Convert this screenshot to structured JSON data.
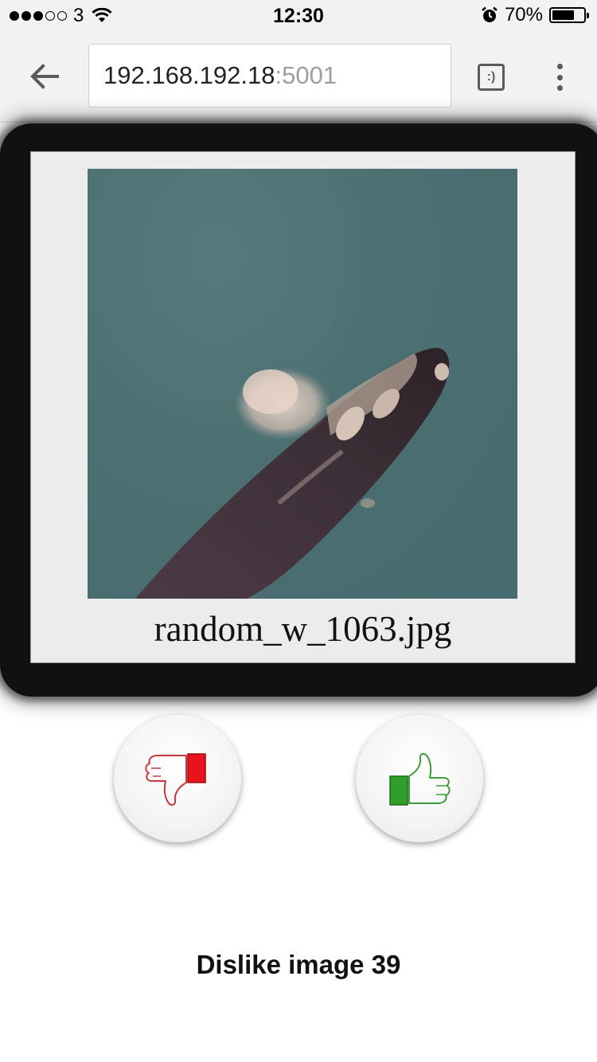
{
  "status_bar": {
    "carrier": "3",
    "time": "12:30",
    "battery": "70%",
    "battery_level": 0.7
  },
  "browser": {
    "url_host": "192.168.192.18",
    "url_port": ":5001",
    "tabs_label": ":)"
  },
  "image_card": {
    "filename": "random_w_1063.jpg"
  },
  "actions": {
    "dislike_icon": "thumbs-down-icon",
    "like_icon": "thumbs-up-icon",
    "dislike_color": "#e8141c",
    "like_color": "#2f9e2a"
  },
  "message": "Dislike image 39"
}
